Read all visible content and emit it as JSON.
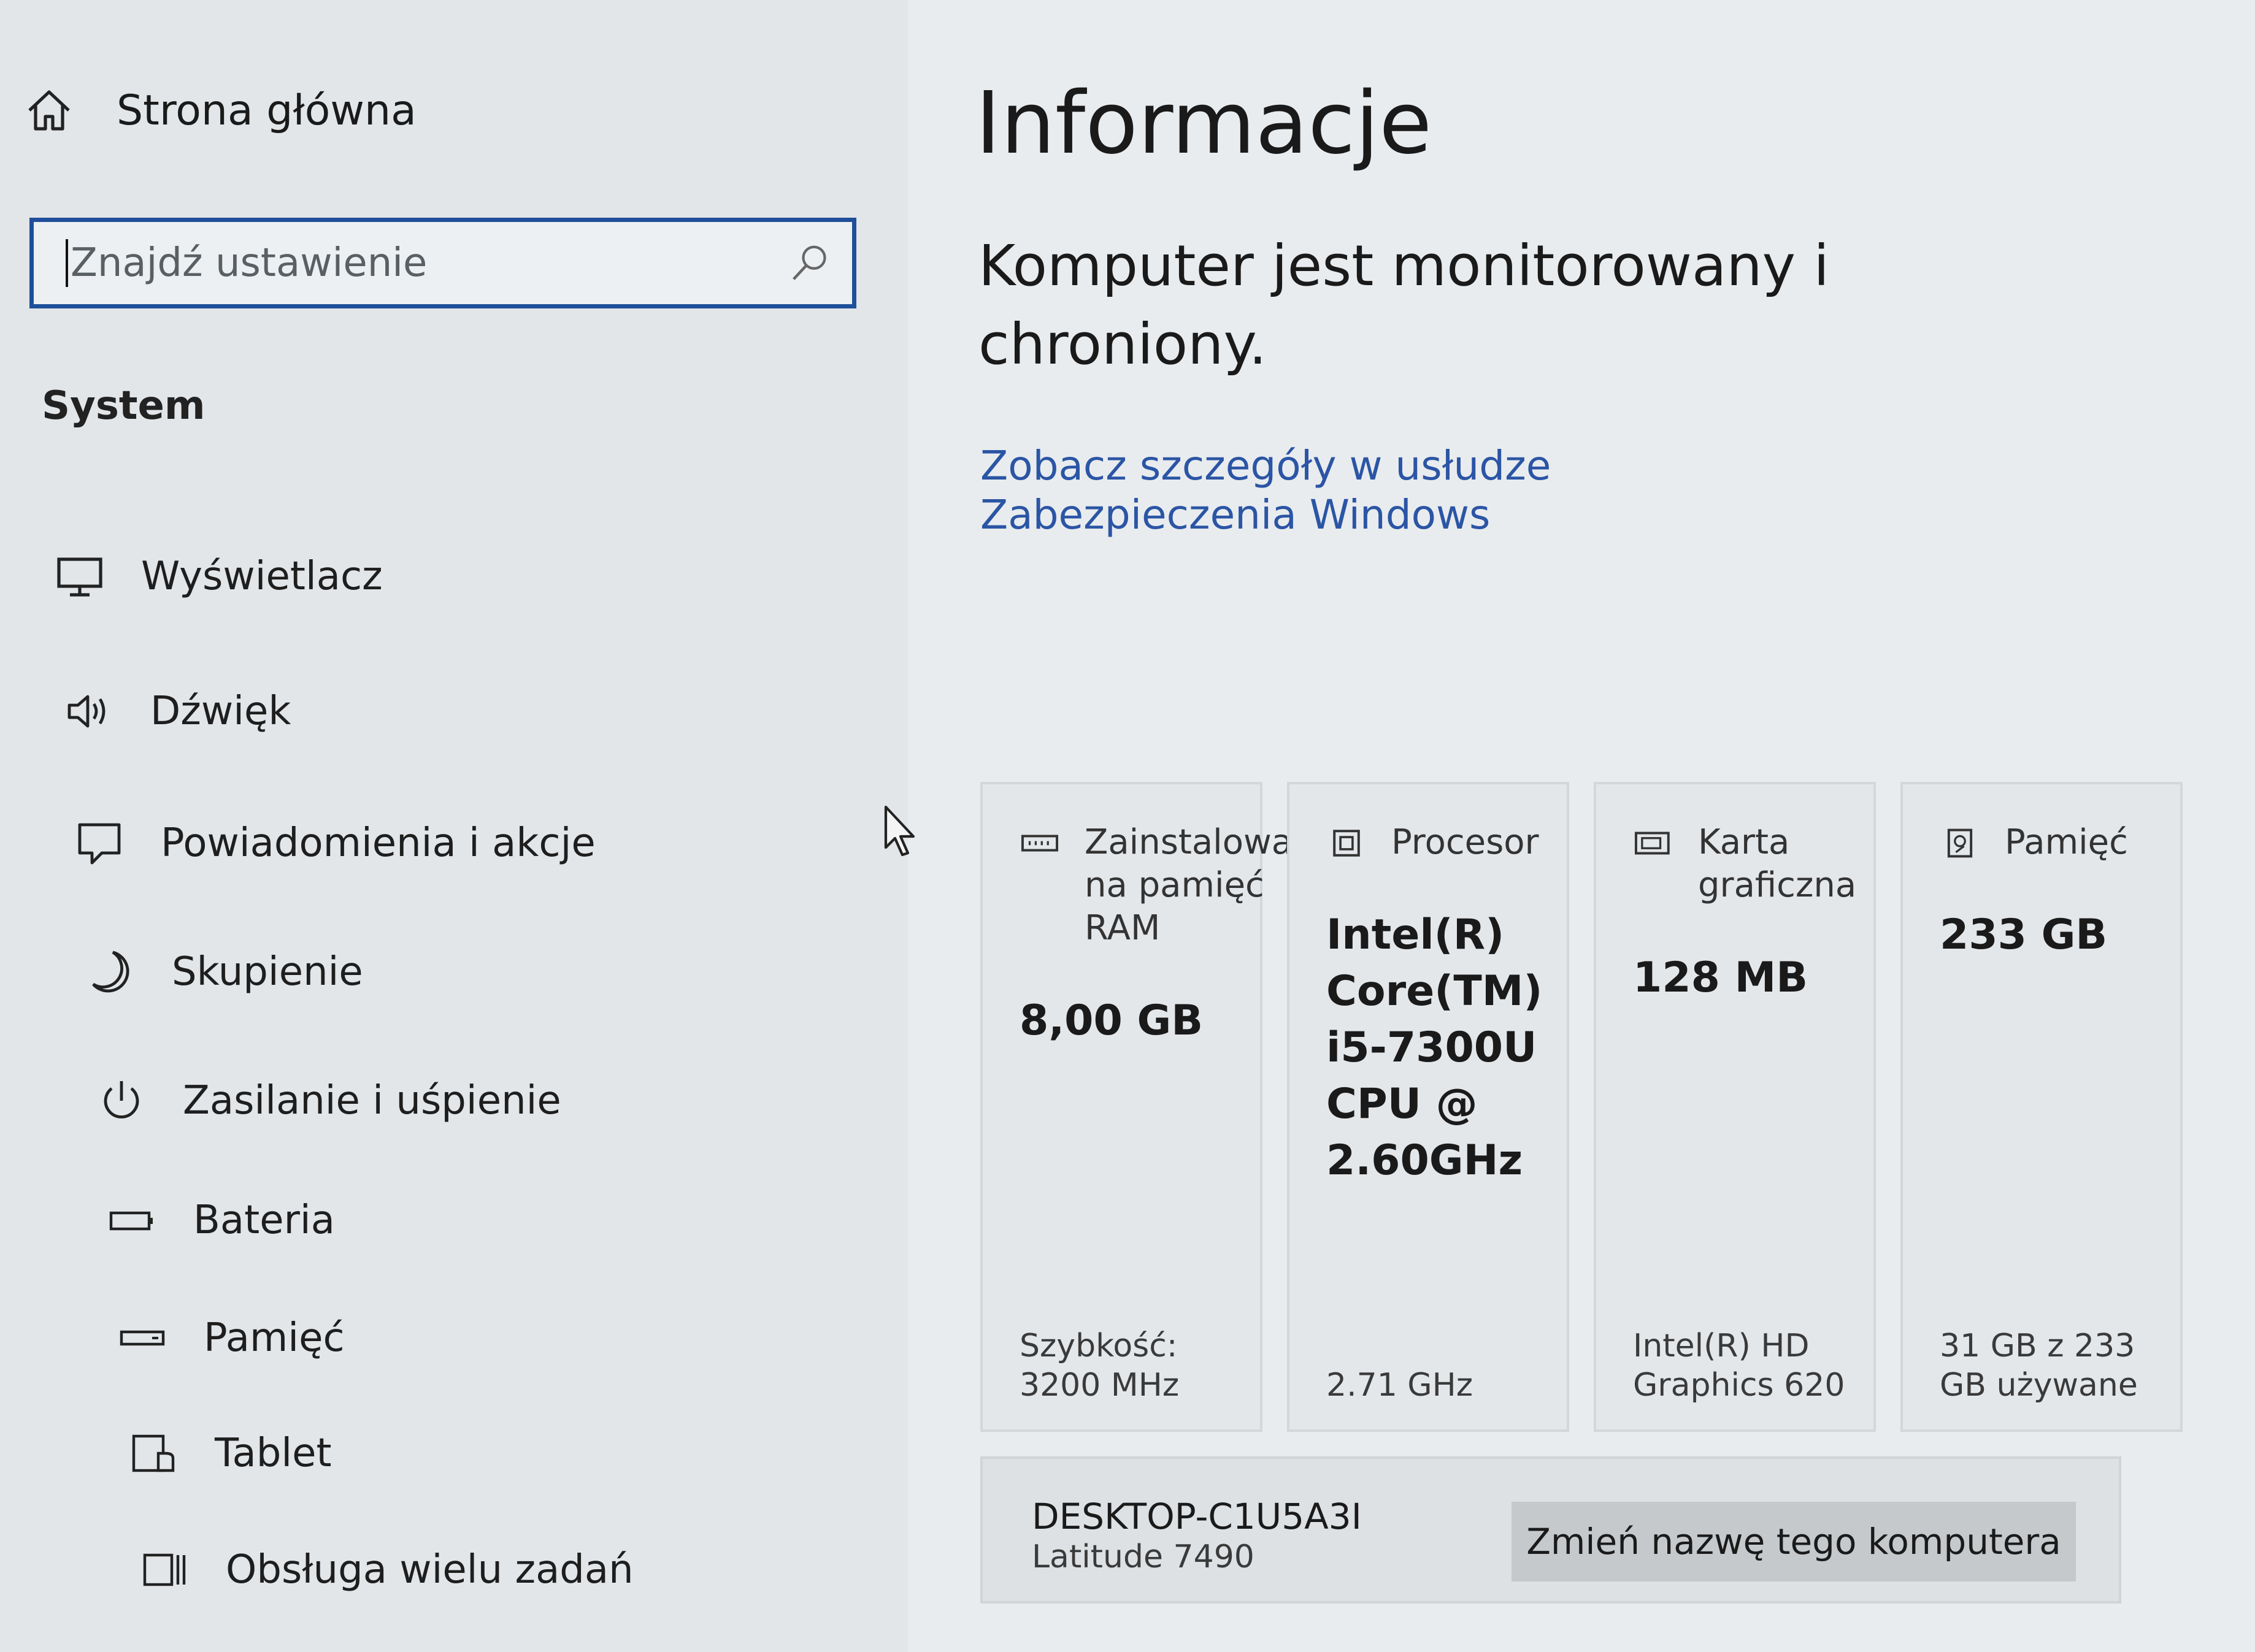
{
  "sidebar": {
    "home_label": "Strona główna",
    "search_placeholder": "Znajdź ustawienie",
    "section_title": "System",
    "items": [
      {
        "label": "Wyświetlacz",
        "icon": "monitor-icon"
      },
      {
        "label": "Dźwięk",
        "icon": "speaker-icon"
      },
      {
        "label": "Powiadomienia i akcje",
        "icon": "notification-icon"
      },
      {
        "label": "Skupienie",
        "icon": "moon-icon"
      },
      {
        "label": "Zasilanie i uśpienie",
        "icon": "power-icon"
      },
      {
        "label": "Bateria",
        "icon": "battery-icon"
      },
      {
        "label": "Pamięć",
        "icon": "storage-icon"
      },
      {
        "label": "Tablet",
        "icon": "tablet-icon"
      },
      {
        "label": "Obsługa wielu zadań",
        "icon": "multitasking-icon"
      }
    ]
  },
  "main": {
    "title": "Informacje",
    "headline": "Komputer jest monitorowany i chroniony.",
    "security_link": "Zobacz szczegóły w usłudze Zabezpieczenia Windows",
    "cards": [
      {
        "title": "Zainstalowana na pamięć RAM",
        "value": "8,00 GB",
        "detail": "Szybkość: 3200 MHz",
        "icon": "ram-icon"
      },
      {
        "title": "Procesor",
        "value": "Intel(R) Core(TM) i5-7300U CPU @ 2.60GHz",
        "detail": "2.71 GHz",
        "icon": "processor-icon"
      },
      {
        "title": "Karta graficzna",
        "value": "128 MB",
        "detail": "Intel(R) HD Graphics 620",
        "icon": "graphics-card-icon"
      },
      {
        "title": "Pamięć",
        "value": "233 GB",
        "detail": "31 GB z 233 GB używane",
        "icon": "disk-icon"
      }
    ],
    "device_name": "DESKTOP-C1U5A3I",
    "device_model": "Latitude 7490",
    "rename_button": "Zmień nazwę tego komputera"
  }
}
